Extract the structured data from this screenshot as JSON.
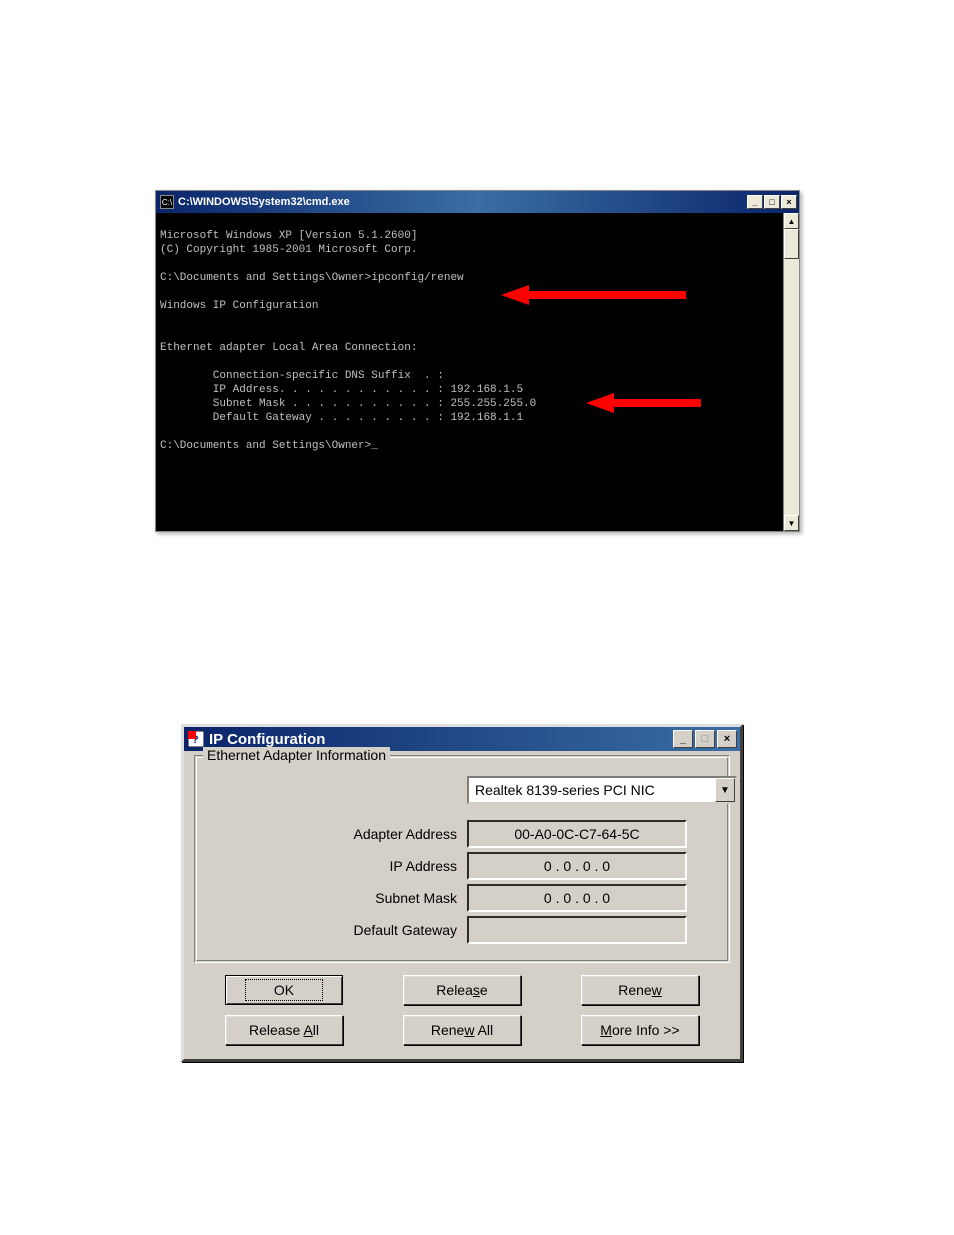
{
  "cmd": {
    "title": "C:\\WINDOWS\\System32\\cmd.exe",
    "icon_label": "C:\\",
    "lines": [
      "Microsoft Windows XP [Version 5.1.2600]",
      "(C) Copyright 1985-2001 Microsoft Corp.",
      "",
      "C:\\Documents and Settings\\Owner>ipconfig/renew",
      "",
      "Windows IP Configuration",
      "",
      "",
      "Ethernet adapter Local Area Connection:",
      "",
      "        Connection-specific DNS Suffix  . :",
      "        IP Address. . . . . . . . . . . . : 192.168.1.5",
      "        Subnet Mask . . . . . . . . . . . : 255.255.255.0",
      "        Default Gateway . . . . . . . . . : 192.168.1.1",
      "",
      "C:\\Documents and Settings\\Owner>_"
    ]
  },
  "ipcfg": {
    "title": "IP Configuration",
    "group_label": "Ethernet  Adapter Information",
    "adapter": "Realtek 8139-series PCI NIC",
    "fields": {
      "adapter_address": {
        "label": "Adapter Address",
        "value": "00-A0-0C-C7-64-5C"
      },
      "ip_address": {
        "label": "IP Address",
        "value": "0 . 0 . 0 . 0"
      },
      "subnet_mask": {
        "label": "Subnet Mask",
        "value": "0 . 0 . 0 . 0"
      },
      "default_gateway": {
        "label": "Default Gateway",
        "value": ""
      }
    },
    "buttons": {
      "ok": "OK",
      "release": "Release",
      "renew": "Renew",
      "release_all": "Release All",
      "renew_all": "Renew All",
      "more_info": "More Info >>"
    }
  }
}
